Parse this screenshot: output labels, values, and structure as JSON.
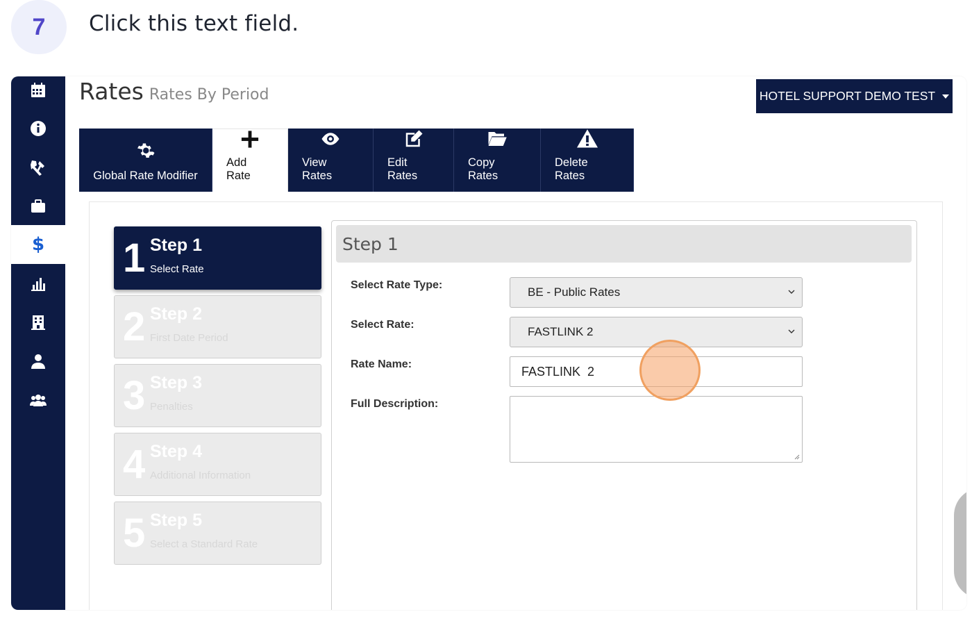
{
  "instruction": {
    "step_number": "7",
    "text": "Click this text field."
  },
  "header": {
    "title": "Rates",
    "subtitle": "Rates By Period",
    "hotel_selector": "HOTEL SUPPORT DEMO TEST"
  },
  "sidebar": {
    "items": [
      {
        "icon": "calendar-icon"
      },
      {
        "icon": "info-icon"
      },
      {
        "icon": "tools-icon"
      },
      {
        "icon": "briefcase-icon"
      },
      {
        "icon": "dollar-icon",
        "label": "$",
        "active": true
      },
      {
        "icon": "bar-chart-icon"
      },
      {
        "icon": "building-icon"
      },
      {
        "icon": "user-icon"
      },
      {
        "icon": "users-icon"
      }
    ]
  },
  "tabs": [
    {
      "label": "Global Rate Modifier",
      "icon": "gear-icon"
    },
    {
      "label": "Add Rate",
      "icon": "plus-icon",
      "active": true
    },
    {
      "label": "View Rates",
      "icon": "eye-icon"
    },
    {
      "label": "Edit Rates",
      "icon": "edit-icon"
    },
    {
      "label": "Copy Rates",
      "icon": "folder-open-icon"
    },
    {
      "label": "Delete Rates",
      "icon": "warning-icon"
    }
  ],
  "wizard": {
    "steps": [
      {
        "number": "1",
        "title": "Step 1",
        "subtitle": "Select Rate",
        "active": true
      },
      {
        "number": "2",
        "title": "Step 2",
        "subtitle": "First Date Period"
      },
      {
        "number": "3",
        "title": "Step 3",
        "subtitle": "Penalties"
      },
      {
        "number": "4",
        "title": "Step 4",
        "subtitle": "Additional Information"
      },
      {
        "number": "5",
        "title": "Step 5",
        "subtitle": "Select a Standard Rate"
      }
    ]
  },
  "form": {
    "heading": "Step 1",
    "rate_type_label": "Select Rate Type:",
    "rate_type_value": "BE - Public Rates",
    "rate_label": "Select Rate:",
    "rate_value": "FASTLINK 2",
    "rate_name_label": "Rate Name:",
    "rate_name_value": "FASTLINK  2",
    "full_description_label": "Full Description:",
    "full_description_value": ""
  },
  "colors": {
    "navy": "#0d1b44",
    "accent_blue": "#1d63dc",
    "click_highlight": "#f0a060",
    "step_badge_text": "#5046c8"
  }
}
